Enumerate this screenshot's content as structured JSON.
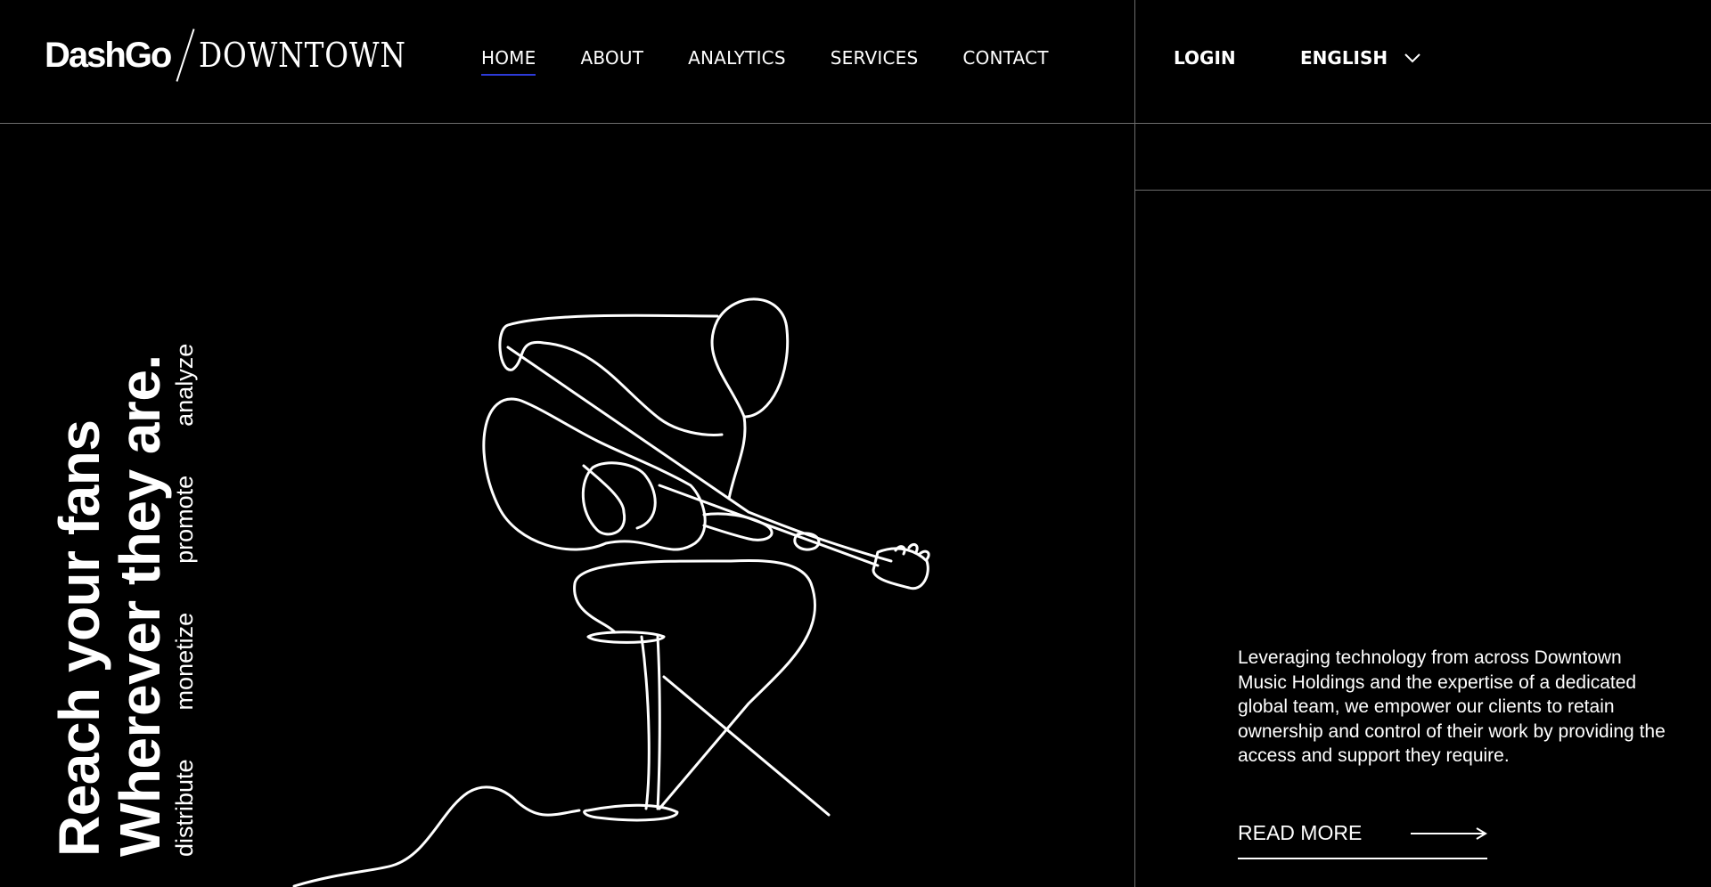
{
  "header": {
    "logo_primary": "DashGo",
    "logo_secondary": "DOWNTOWN",
    "nav": [
      {
        "label": "HOME",
        "active": true
      },
      {
        "label": "ABOUT",
        "active": false
      },
      {
        "label": "ANALYTICS",
        "active": false
      },
      {
        "label": "SERVICES",
        "active": false
      },
      {
        "label": "CONTACT",
        "active": false
      }
    ],
    "login_label": "LOGIN",
    "language_label": "ENGLISH",
    "language_icon": "chevron-down-icon"
  },
  "hero": {
    "headline_line1": "Reach your fans",
    "headline_line2": "Wherever they are.",
    "verbs": [
      "distribute",
      "monetize",
      "promote",
      "analyze"
    ],
    "illustration": "guitar-player-line-art"
  },
  "panel": {
    "description": "Leveraging technology from across Downtown Music Holdings and the expertise of a dedicated global team, we empower our clients to retain ownership and control of their work by providing the access and support they require.",
    "read_more_label": "READ MORE",
    "read_more_icon": "arrow-right-icon"
  },
  "colors": {
    "background": "#000000",
    "text": "#ffffff",
    "active_underline": "#2d3ad8",
    "divider": "#6d6d6d"
  }
}
